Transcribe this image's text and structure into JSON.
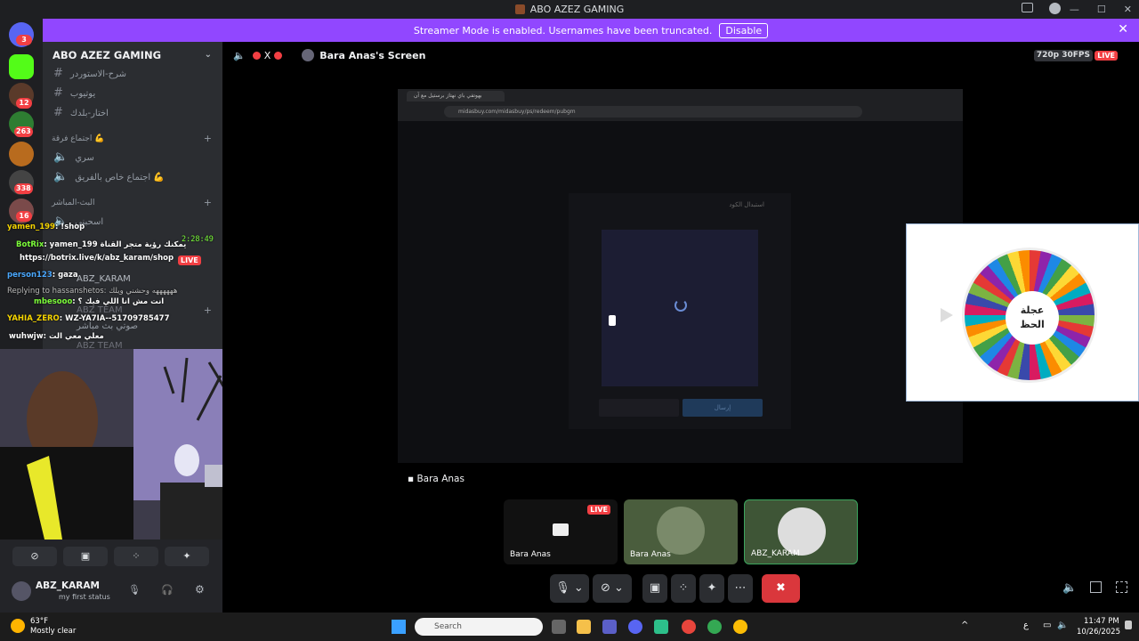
{
  "window": {
    "title": "ABO AZEZ GAMING",
    "controls": [
      "—",
      "☐",
      "✕"
    ]
  },
  "banner": {
    "text": "Streamer Mode is enabled. Usernames have been truncated.",
    "disable_label": "Disable",
    "close": "✕"
  },
  "servers": {
    "badges": [
      "3",
      "12",
      "263",
      "338",
      "16"
    ]
  },
  "sidebar": {
    "server_name": "ABO AZEZ GAMING",
    "channels": [
      {
        "icon": "#",
        "label": "شرح-الاستوردر"
      },
      {
        "icon": "#",
        "label": "يوتيوب"
      },
      {
        "icon": "#",
        "label": "اختار-بلدك"
      }
    ],
    "category1": "اجتماع فرقة 💪",
    "voice1": [
      {
        "label": "سري"
      },
      {
        "label": "اجتماع خاص بالفريق 💪"
      }
    ],
    "category2": "البث-المباشر",
    "voice2": [
      {
        "label": "اسحبني"
      }
    ],
    "member": "ABZ_KARAM",
    "team1": "ABZ TEAM",
    "voice3": "صوتي بث مباشر",
    "team2": "ABZ TEAM",
    "live": "LIVE"
  },
  "chat": {
    "timer": "2:28:49",
    "lines": [
      {
        "user": "yamen_199",
        "text": ": !shop"
      },
      {
        "user": "BotRix",
        "text": ": yamen_199 يمكنك رؤية متجر القناة"
      },
      {
        "user": "",
        "text": "https://botrix.live/k/abz_karam/shop"
      },
      {
        "user": "person123",
        "text": ": gaza"
      },
      {
        "user": "",
        "text": "Replying to hassanshetos: ههههههه وحشني ويلك"
      },
      {
        "user": "mbesooo",
        "text": ": انت مش انا اللي فيك ؟"
      },
      {
        "user": "YAHIA_ZERO",
        "text": ": WZ-YA7IA--51709785477"
      },
      {
        "user": "wuhwjw",
        "text": ": معلي معي الت"
      }
    ]
  },
  "user": {
    "name": "ABZ_KARAM",
    "status": "my first status"
  },
  "stage": {
    "streamer": "Bara Anas's Screen",
    "quality": "720p 30FPS",
    "live": "LIVE",
    "stream_label": "Bara Anas",
    "tiles": [
      {
        "name": "Bara Anas",
        "live": "LIVE"
      },
      {
        "name": "Bara Anas"
      },
      {
        "name": "ABZ_KARAM"
      }
    ]
  },
  "browser": {
    "tab": "بهوتفي باي نهتاز برستيل مع آن",
    "url": "midasbuy.com/midasbuy/ps/redeem/pubgm",
    "modal_title": "استبدال الكود",
    "modal_button": "إرسال"
  },
  "wheel": {
    "line1": "عجلة",
    "line2": "الحظ"
  },
  "taskbar": {
    "weather_temp": "63°F",
    "weather_desc": "Mostly clear",
    "search": "Search",
    "time": "11:47 PM",
    "date": "10/26/2025",
    "lang": "ع"
  }
}
